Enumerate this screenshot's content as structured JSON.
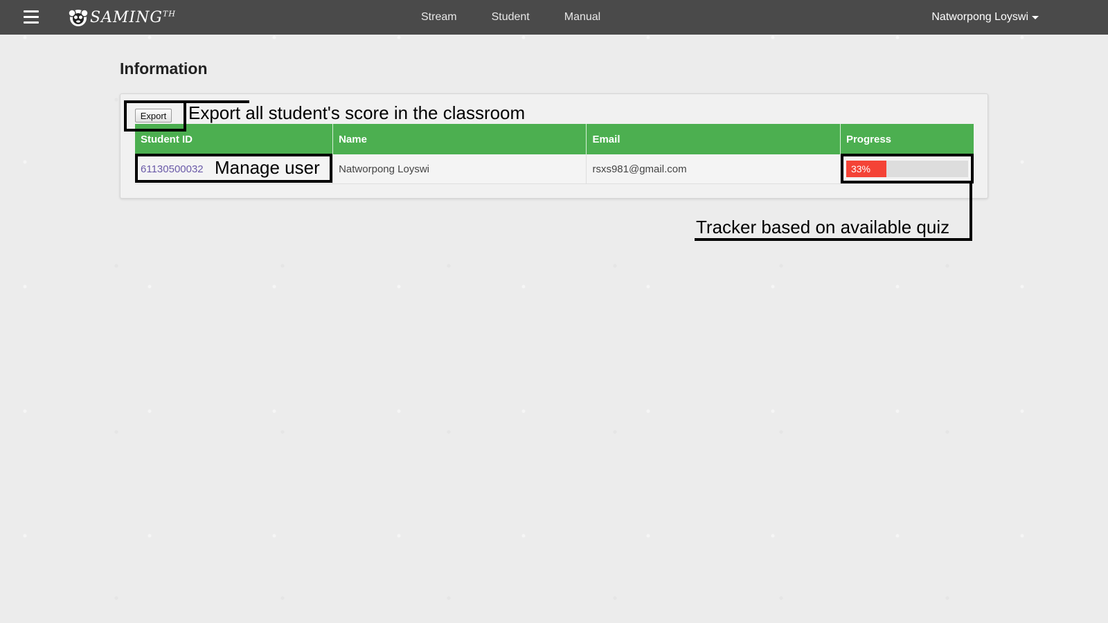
{
  "navbar": {
    "menu_icon": "hamburger-menu-icon",
    "logo": {
      "icon": "monkey-logo-icon",
      "text": "SAMING",
      "superscript": "TH"
    },
    "links": [
      {
        "label": "Stream"
      },
      {
        "label": "Student"
      },
      {
        "label": "Manual"
      }
    ],
    "user": {
      "name": "Natworpong Loyswi",
      "icon": "caret-down-icon"
    }
  },
  "page": {
    "title": "Information"
  },
  "toolbar": {
    "export_label": "Export"
  },
  "table": {
    "headers": [
      "Student ID",
      "Name",
      "Email",
      "Progress"
    ],
    "rows": [
      {
        "student_id": "61130500032",
        "name": "Natworpong Loyswi",
        "email": "rsxs981@gmail.com",
        "progress_label": "33%",
        "progress_value": 0.33,
        "progress_color": "#f44336"
      }
    ]
  },
  "annotations": {
    "export": "Export all student's score in the classroom",
    "manage": "Manage user",
    "tracker": "Tracker based on available quiz"
  },
  "colors": {
    "navbar": "#4a4a4a",
    "header": "#4caf50",
    "link": "#6a5aa8",
    "progress_fill": "#f44336",
    "progress_track": "#dddddd"
  }
}
